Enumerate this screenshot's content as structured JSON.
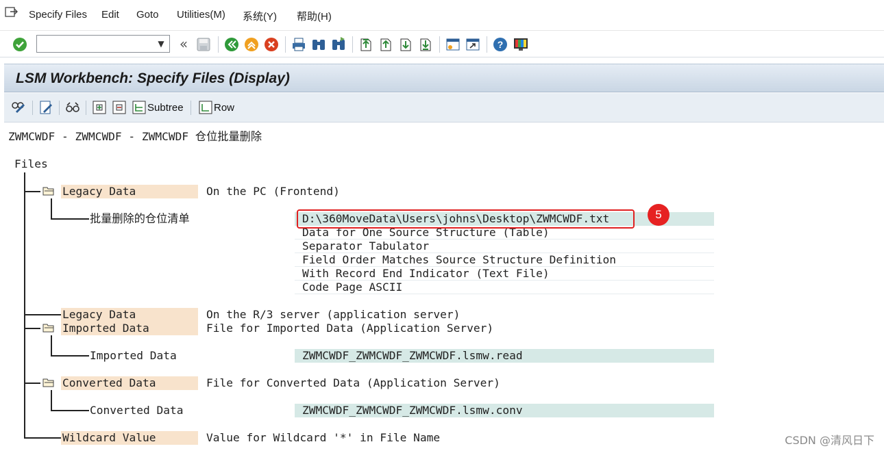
{
  "menubar": {
    "items": [
      "Specify Files",
      "Edit",
      "Goto",
      "Utilities(M)",
      "系统(Y)",
      "帮助(H)"
    ]
  },
  "toolbar": {
    "command_field_value": "",
    "back_label": "«"
  },
  "title": "LSM Workbench: Specify Files (Display)",
  "app_toolbar": {
    "subtree_label": "Subtree",
    "row_label": "Row"
  },
  "content": {
    "header": "ZWMCWDF - ZWMCWDF - ZWMCWDF 仓位批量删除",
    "files_label": "Files",
    "legacy_pc": {
      "label": "Legacy Data",
      "description": "On the PC (Frontend)",
      "file_name": "批量删除的仓位清单",
      "path": "D:\\360MoveData\\Users\\johns\\Desktop\\ZWMCWDF.txt",
      "properties": [
        "Data for One Source Structure (Table)",
        "Separator Tabulator",
        "Field Order Matches Source Structure Definition",
        "With Record End Indicator (Text File)",
        "Code Page ASCII"
      ]
    },
    "legacy_server": {
      "label": "Legacy Data",
      "description": "On the R/3 server (application server)"
    },
    "imported": {
      "label": "Imported Data",
      "description": "File for Imported Data (Application Server)",
      "child_label": "Imported Data",
      "child_value": "ZWMCWDF_ZWMCWDF_ZWMCWDF.lsmw.read"
    },
    "converted": {
      "label": "Converted Data",
      "description": "File for Converted Data (Application Server)",
      "child_label": "Converted Data",
      "child_value": "ZWMCWDF_ZWMCWDF_ZWMCWDF.lsmw.conv"
    },
    "wildcard": {
      "label": "Wildcard Value",
      "description": "Value for Wildcard '*' in File Name"
    }
  },
  "annotation": {
    "marker": "5"
  },
  "watermark": "CSDN @清风日下",
  "colors": {
    "label_bg": "#f8e3cc",
    "value_bg": "#d6e9e6",
    "title_bar": "#c9d6e4",
    "highlight_red": "#e02020"
  }
}
